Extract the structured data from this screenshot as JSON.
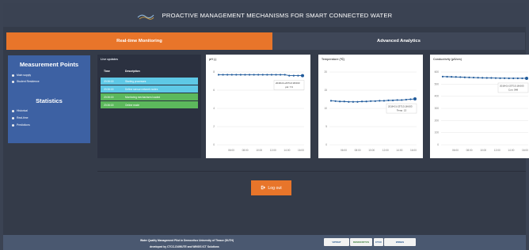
{
  "header": {
    "title": "PROACTIVE MANAGEMENT MECHANISMS FOR SMART CONNECTED WATER",
    "logo_icon": "water-wave-logo-icon"
  },
  "tabs": [
    {
      "label": "Real-time Monitoring",
      "active": true
    },
    {
      "label": "Advanced Analytics",
      "active": false
    }
  ],
  "sidebar": {
    "measurement_heading": "Measurement Points",
    "measurement_items": [
      "Main supply",
      "Student Residence"
    ],
    "statistics_heading": "Statistics",
    "statistics_items": [
      "Historical",
      "Real-time",
      "Predictions"
    ]
  },
  "live_updates": {
    "title": "Live updates",
    "columns": [
      "Time",
      "Description"
    ],
    "rows": [
      {
        "time": "20:36:15",
        "description": "Starting processes",
        "color": "#5ec8e6"
      },
      {
        "time": "20:36:15",
        "description": "Define sensor network nodes",
        "color": "#5ec8e6"
      },
      {
        "time": "20:36:15",
        "description": "Monitoring mechanisms loaded",
        "color": "#5cb85c"
      },
      {
        "time": "20:36:15",
        "description": "Online mode​",
        "color": "#5cb85c"
      }
    ]
  },
  "charts": [
    {
      "title": "pH (-)",
      "tooltip_date": "2018-01-23T13:18:003",
      "tooltip_value": "pH: 7.6",
      "chart_data": {
        "type": "line",
        "x": [
          "06:00",
          "08:00",
          "10:00",
          "12:00",
          "14:00",
          "16:00"
        ],
        "ylim": [
          0,
          8
        ],
        "yticks": [
          "0",
          "2",
          "4",
          "6",
          "8"
        ],
        "values": [
          7.7,
          7.7,
          7.7,
          7.7,
          7.7,
          7.7,
          7.7,
          7.7,
          7.7,
          7.7,
          7.7,
          7.7,
          7.7,
          7.7,
          7.7,
          7.7,
          7.6,
          7.6,
          7.6,
          7.6
        ]
      }
    },
    {
      "title": "Temperature (℃)",
      "tooltip_date": "2018-01-23T13:18:003",
      "tooltip_value": "Temp: 13",
      "chart_data": {
        "type": "line",
        "x": [
          "06:00",
          "08:00",
          "10:00",
          "12:00",
          "14:00",
          "16:00"
        ],
        "ylim": [
          0,
          20
        ],
        "yticks": [
          "0",
          "5",
          "10",
          "15",
          "20"
        ],
        "values": [
          12.1,
          12.0,
          11.9,
          11.9,
          11.8,
          11.8,
          11.8,
          11.9,
          11.9,
          12.0,
          12.0,
          12.1,
          12.1,
          12.2,
          12.2,
          12.3,
          12.3,
          12.4,
          12.5,
          12.6
        ]
      }
    },
    {
      "title": "Conductivity (μS/cm)",
      "tooltip_date": "2018-01-23T13:18:003",
      "tooltip_value": "Con: 548",
      "chart_data": {
        "type": "line",
        "x": [
          "06:00",
          "08:00",
          "10:00",
          "12:00",
          "14:00",
          "16:00"
        ],
        "ylim": [
          0,
          600
        ],
        "yticks": [
          "0",
          "100",
          "200",
          "300",
          "400",
          "500",
          "600"
        ],
        "values": [
          562,
          561,
          560,
          559,
          558,
          556,
          555,
          554,
          553,
          552,
          551,
          551,
          550,
          549,
          549,
          548,
          548,
          548,
          548,
          548
        ]
      }
    }
  ],
  "logout": {
    "label": "Log out",
    "icon": "logout-icon"
  },
  "footer": {
    "line1": "Water Quality Management Pilot in Democritus University of Thrace (DUTH)",
    "line2": "developed by CTCC-DUWUTE and WINGS ICT Solutions",
    "partners": [
      "ViPWAT",
      "DEMOCRITUS",
      "CTCC",
      "WINGS"
    ]
  }
}
